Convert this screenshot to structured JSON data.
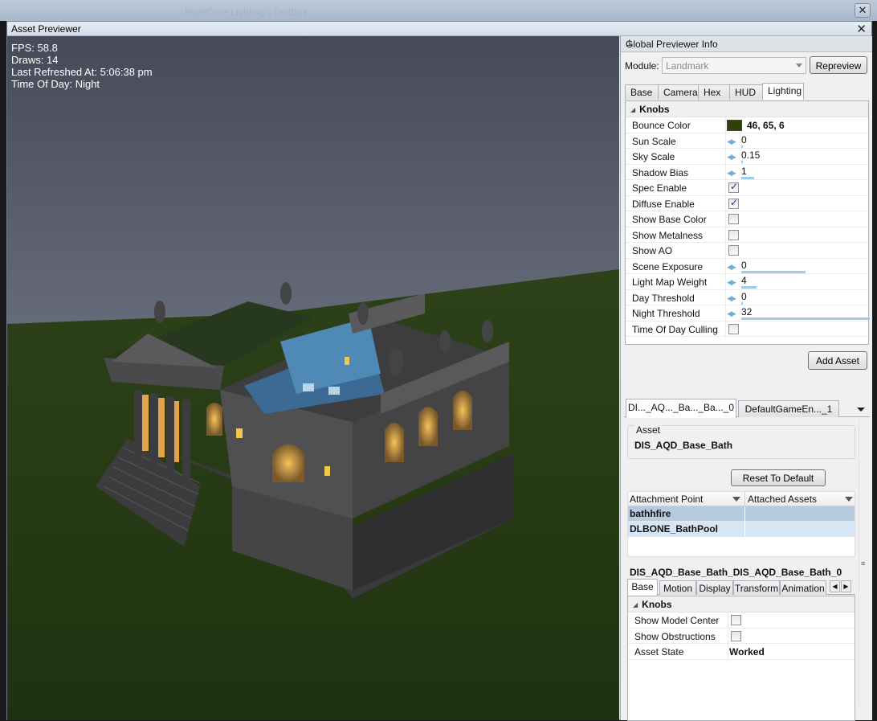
{
  "outer": {
    "ghost_title": "NightCore Lighting - ToolBox"
  },
  "window": {
    "title": "Asset Previewer",
    "close": "✕"
  },
  "hud": {
    "fps": "FPS: 58.8",
    "draws": "Draws: 14",
    "refreshed": "Last Refreshed At: 5:06:38 pm",
    "time_of_day": "Time Of Day: Night"
  },
  "global": {
    "title": "Global Previewer Info",
    "pin": "⊥",
    "module_label": "Module:",
    "module_value": "Landmark",
    "repreview": "Repreview",
    "tabs": [
      "Base",
      "Camera",
      "Hex",
      "HUD",
      "Lighting"
    ],
    "category": "Knobs",
    "props": {
      "bounce_color": {
        "name": "Bounce Color",
        "value": "46, 65, 6",
        "color": "#2e4106"
      },
      "sun_scale": {
        "name": "Sun Scale",
        "value": "0",
        "fill": 0.0
      },
      "sky_scale": {
        "name": "Sky Scale",
        "value": "0.15",
        "fill": 0.01
      },
      "shadow_bias": {
        "name": "Shadow Bias",
        "value": "1",
        "fill": 0.1
      },
      "spec_enable": {
        "name": "Spec Enable",
        "checked": true
      },
      "diffuse_enable": {
        "name": "Diffuse Enable",
        "checked": true
      },
      "show_base_color": {
        "name": "Show Base Color",
        "checked": false
      },
      "show_metalness": {
        "name": "Show Metalness",
        "checked": false
      },
      "show_ao": {
        "name": "Show AO",
        "checked": false
      },
      "scene_exposure": {
        "name": "Scene Exposure",
        "value": "0",
        "fill": 0.5
      },
      "light_map_weight": {
        "name": "Light Map Weight",
        "value": "4",
        "fill": 0.12
      },
      "day_threshold": {
        "name": "Day Threshold",
        "value": "0",
        "fill": 0.0
      },
      "night_threshold": {
        "name": "Night Threshold",
        "value": "32",
        "fill": 1.0
      },
      "time_of_day_culling": {
        "name": "Time Of Day Culling",
        "checked": false
      }
    },
    "add_asset": "Add Asset"
  },
  "asset_tabs": [
    "DI..._AQ..._Ba..._Ba..._0",
    "DefaultGameEn..._1"
  ],
  "asset": {
    "legend": "Asset",
    "value": "DIS_AQD_Base_Bath",
    "reset": "Reset To Default",
    "columns": [
      "Attachment Point",
      "Attached Assets"
    ],
    "rows": [
      "bathhfire",
      "DLBONE_BathPool"
    ],
    "instance_title": "DIS_AQD_Base_Bath_DIS_AQD_Base_Bath_0",
    "sub_tabs": [
      "Base",
      "Motion",
      "Display",
      "Transform",
      "Animation"
    ],
    "category": "Knobs",
    "props": {
      "show_model_center": {
        "name": "Show Model Center",
        "checked": false
      },
      "show_obstructions": {
        "name": "Show Obstructions",
        "checked": false
      },
      "asset_state": {
        "name": "Asset State",
        "value": "Worked"
      }
    }
  }
}
